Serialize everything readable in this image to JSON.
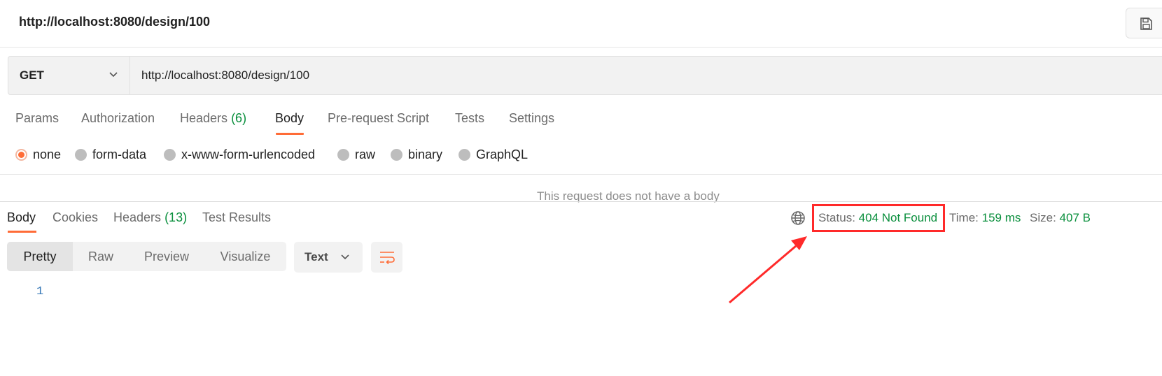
{
  "header": {
    "title": "http://localhost:8080/design/100"
  },
  "request": {
    "method": "GET",
    "url": "http://localhost:8080/design/100"
  },
  "request_tabs": [
    {
      "label": "Params",
      "count": ""
    },
    {
      "label": "Authorization",
      "count": ""
    },
    {
      "label": "Headers",
      "count": "(6)"
    },
    {
      "label": "Body",
      "count": "",
      "active": true
    },
    {
      "label": "Pre-request Script",
      "count": ""
    },
    {
      "label": "Tests",
      "count": ""
    },
    {
      "label": "Settings",
      "count": ""
    }
  ],
  "body_types": [
    {
      "label": "none",
      "selected": true
    },
    {
      "label": "form-data",
      "selected": false
    },
    {
      "label": "x-www-form-urlencoded",
      "selected": false
    },
    {
      "label": "raw",
      "selected": false
    },
    {
      "label": "binary",
      "selected": false
    },
    {
      "label": "GraphQL",
      "selected": false
    }
  ],
  "no_body_message": "This request does not have a body",
  "response": {
    "tabs": [
      {
        "label": "Body",
        "count": "",
        "active": true
      },
      {
        "label": "Cookies",
        "count": ""
      },
      {
        "label": "Headers",
        "count": "(13)"
      },
      {
        "label": "Test Results",
        "count": ""
      }
    ],
    "status_label": "Status:",
    "status_value": "404 Not Found",
    "time_label": "Time:",
    "time_value": "159 ms",
    "size_label": "Size:",
    "size_value": "407 B",
    "views": [
      "Pretty",
      "Raw",
      "Preview",
      "Visualize"
    ],
    "active_view": "Pretty",
    "format": "Text",
    "line_numbers": [
      "1"
    ]
  },
  "colors": {
    "accent": "#ff6c37",
    "success_text": "#0a8f3d",
    "annotation_red": "#ff2a2a"
  },
  "icons": {
    "save": "save-icon",
    "method_dropdown": "chevron-down-icon",
    "globe": "globe-icon",
    "format_dropdown": "chevron-down-icon",
    "wrap": "wrap-lines-icon"
  }
}
